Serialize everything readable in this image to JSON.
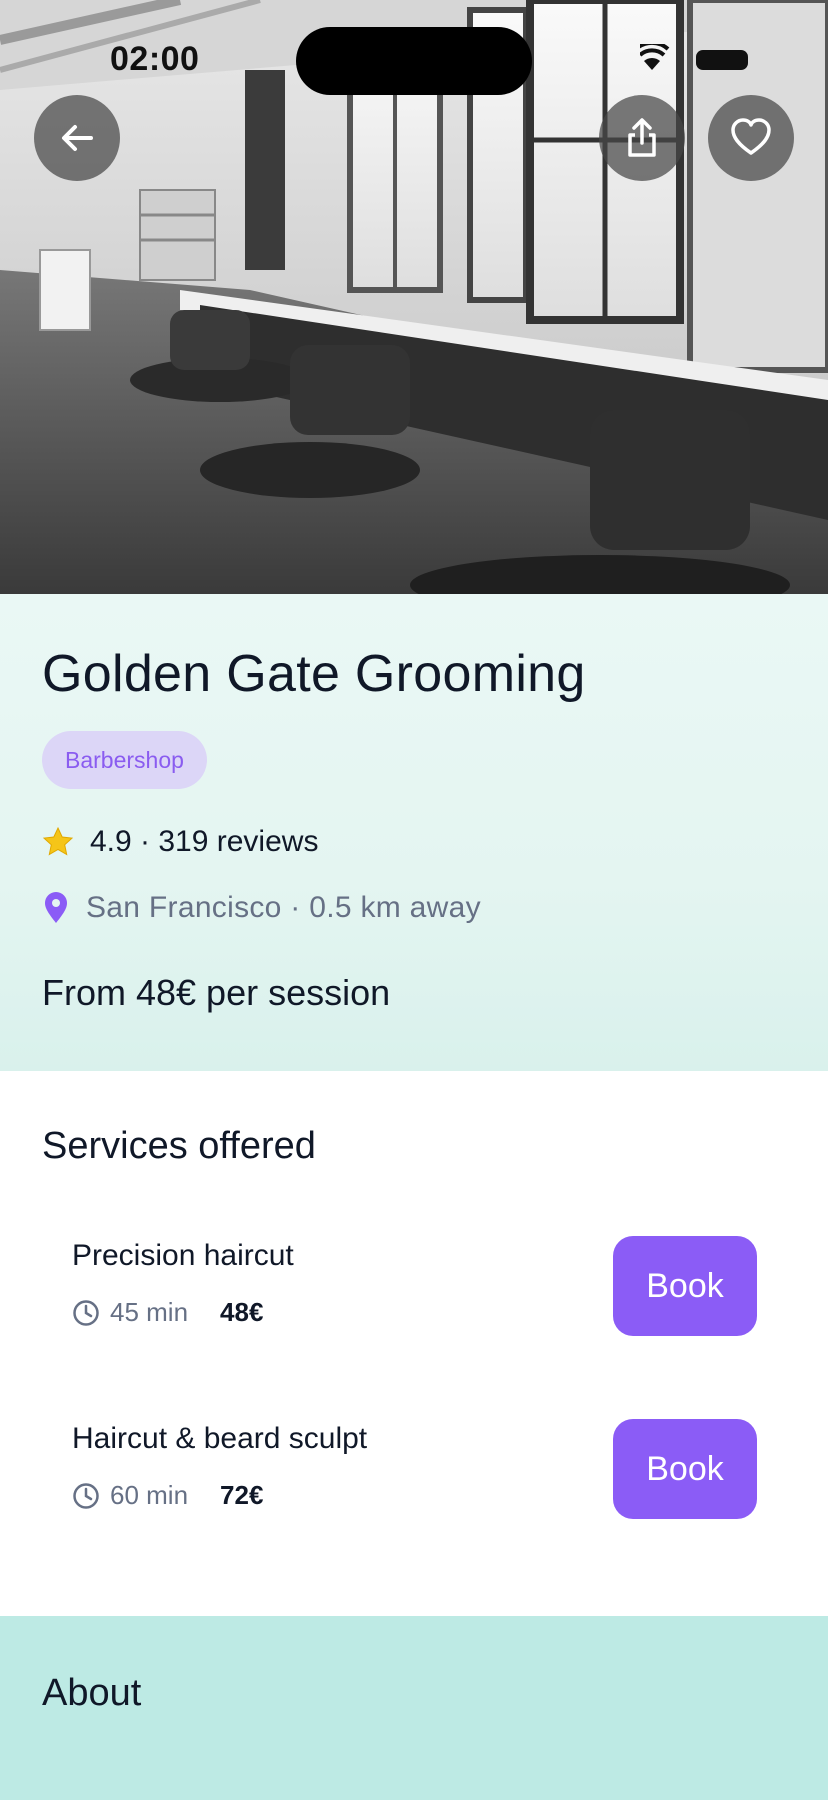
{
  "status_bar": {
    "time": "02:00"
  },
  "nav": {
    "back_icon": "arrow-left-icon",
    "share_icon": "share-icon",
    "favorite_icon": "heart-icon"
  },
  "salon": {
    "name": "Golden Gate Grooming",
    "category": "Barbershop",
    "rating_text": "4.9 · 319 reviews",
    "rating": 4.9,
    "review_count": 319,
    "location_text": "San Francisco · 0.5 km away",
    "price_from": "From 48€ per session"
  },
  "services": {
    "title": "Services offered",
    "items": [
      {
        "name": "Precision haircut",
        "duration": "45 min",
        "price": "48€",
        "book_label": "Book"
      },
      {
        "name": "Haircut & beard sculpt",
        "duration": "60 min",
        "price": "72€",
        "book_label": "Book"
      }
    ]
  },
  "about": {
    "title": "About"
  },
  "colors": {
    "accent": "#8b5cf6",
    "badge_bg": "#dcd6f7",
    "badge_text": "#8a5cf0",
    "info_bg": "#e4f5f1",
    "about_bg": "#bdeae4",
    "text_primary": "#101828",
    "text_secondary": "#667085"
  }
}
